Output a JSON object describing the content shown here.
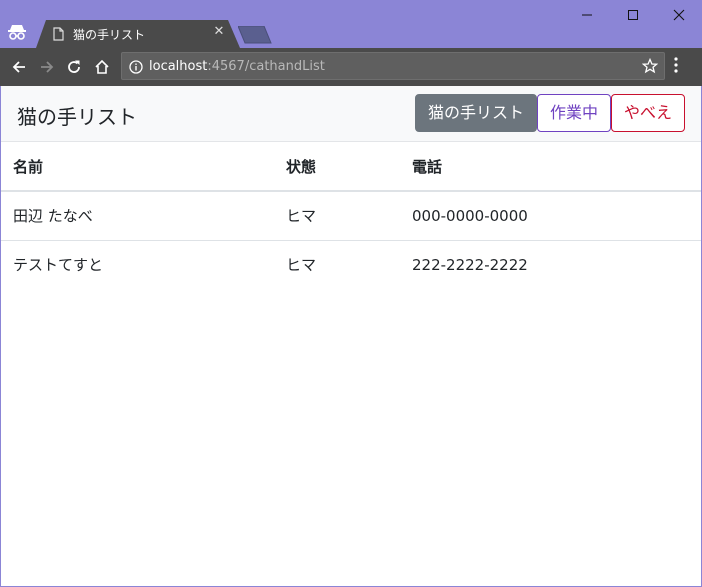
{
  "browser": {
    "tab_title": "猫の手リスト",
    "url_host": "localhost",
    "url_path": ":4567/cathandList"
  },
  "navbar": {
    "brand": "猫の手リスト",
    "buttons": {
      "list": "猫の手リスト",
      "working": "作業中",
      "danger": "やべえ"
    }
  },
  "table": {
    "headers": [
      "名前",
      "状態",
      "電話"
    ],
    "rows": [
      [
        "田辺 たなべ",
        "ヒマ",
        "000-0000-0000"
      ],
      [
        "テストてすと",
        "ヒマ",
        "222-2222-2222"
      ]
    ]
  },
  "icons": {
    "incognito": "incognito-icon",
    "page": "page-icon",
    "close": "close-icon",
    "back": "arrow-left-icon",
    "forward": "arrow-right-icon",
    "reload": "reload-icon",
    "home": "home-icon",
    "info": "info-icon",
    "star": "star-icon",
    "menu": "menu-dots-icon"
  },
  "colors": {
    "titlebar": "#8b85d6",
    "toolbar": "#4a4a4a",
    "btn_secondary": "#6c757d",
    "btn_purple": "#6f42c1",
    "btn_danger": "#c8102e"
  }
}
